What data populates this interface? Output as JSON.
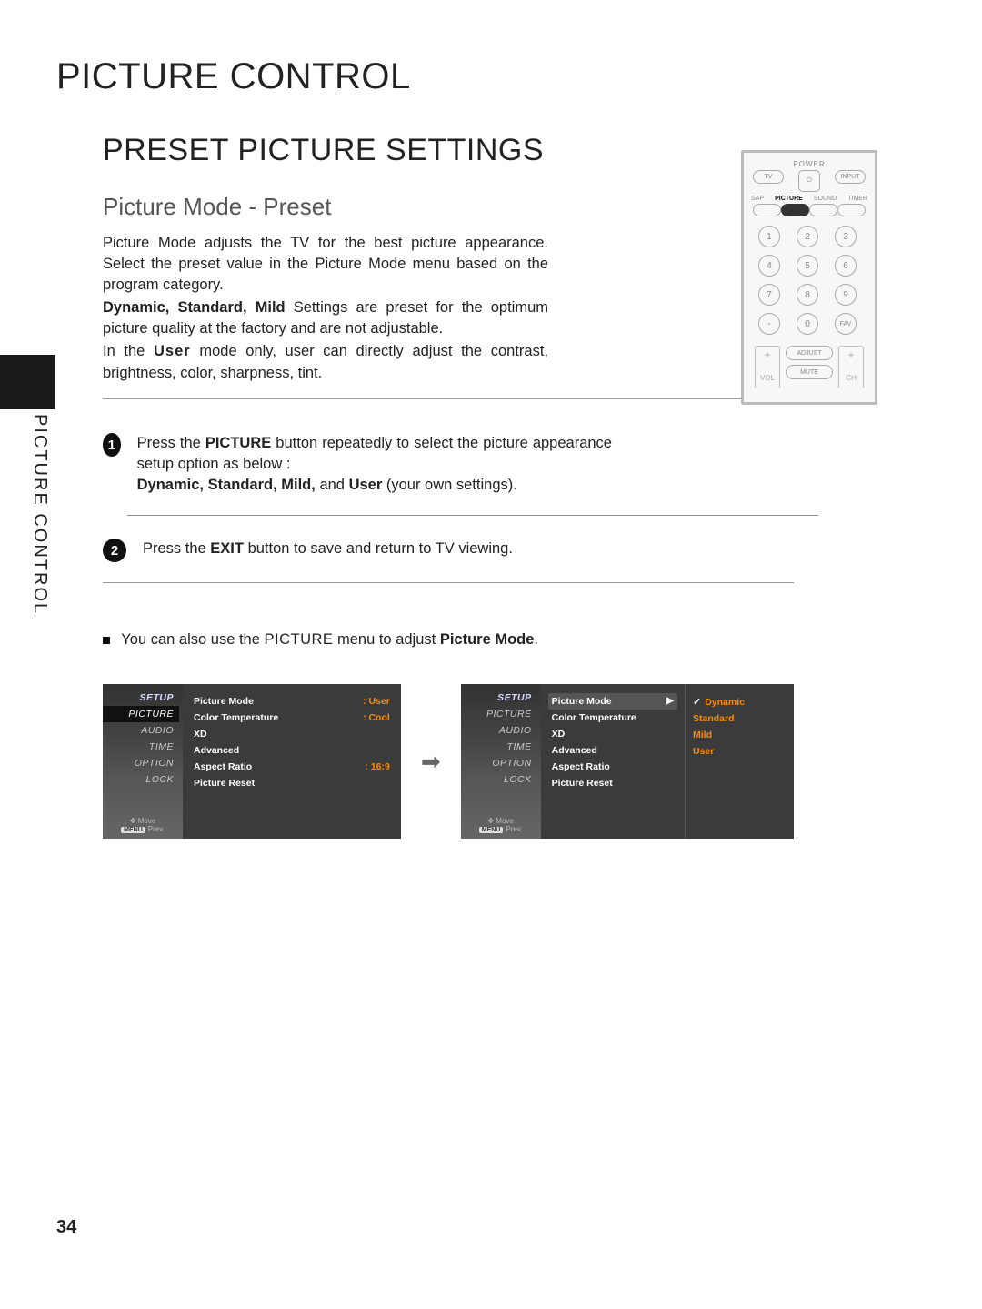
{
  "page": {
    "title": "PICTURE CONTROL",
    "section": "PRESET PICTURE SETTINGS",
    "subsection": "Picture Mode - Preset",
    "side_label": "PICTURE CONTROL",
    "page_number": "34"
  },
  "intro": {
    "p1a": "Picture Mode adjusts the TV for the best picture appearance. Select the preset value in the Picture Mode menu based on the program category.",
    "p2_bold": "Dynamic, Standard, Mild",
    "p2_rest": " Settings are preset for the optimum picture quality at the factory and are not adjustable.",
    "p3a": "In the ",
    "p3_user": "User",
    "p3b": " mode only, user can directly adjust the contrast, brightness, color, sharpness, tint."
  },
  "steps": {
    "s1": {
      "num": "1",
      "line1a": "Press the ",
      "line1b": "PICTURE",
      "line1c": " button repeatedly to select the picture appearance setup option as below :",
      "line2": "Dynamic, Standard, Mild,",
      "line2_and": " and ",
      "line2_user": "User",
      "line2_tail": " (your own settings)."
    },
    "s2": {
      "num": "2",
      "a": "Press the ",
      "b": "EXIT",
      "c": " button to save and return to TV viewing."
    }
  },
  "tip": {
    "a": "You can also use the ",
    "b": "PICTURE",
    "c": " menu to adjust ",
    "d": "Picture Mode",
    "e": "."
  },
  "remote": {
    "power": "POWER",
    "tv": "TV",
    "input": "INPUT",
    "sap": "SAP",
    "picture": "PICTURE",
    "sound": "SOUND",
    "timer": "TIMER",
    "nums": [
      "1",
      "2",
      "3",
      "4",
      "5",
      "6",
      "7",
      "8",
      "9",
      "-",
      "0",
      "FAV"
    ],
    "adjust": "ADJUST",
    "mute": "MUTE",
    "vol": "VOL",
    "ch": "CH",
    "plus": "+"
  },
  "osd": {
    "tabs": [
      "SETUP",
      "PICTURE",
      "AUDIO",
      "TIME",
      "OPTION",
      "LOCK"
    ],
    "move": "Move",
    "prev": "Prev.",
    "menu_prev": "MENU",
    "left": {
      "items": [
        {
          "label": "Picture Mode",
          "value": ": User"
        },
        {
          "label": "Color Temperature",
          "value": ": Cool"
        },
        {
          "label": "XD",
          "value": ""
        },
        {
          "label": "Advanced",
          "value": ""
        },
        {
          "label": "Aspect Ratio",
          "value": ": 16:9"
        },
        {
          "label": "Picture Reset",
          "value": ""
        }
      ]
    },
    "right": {
      "items": [
        {
          "label": "Picture Mode",
          "arrow": true
        },
        {
          "label": "Color Temperature"
        },
        {
          "label": "XD"
        },
        {
          "label": "Advanced"
        },
        {
          "label": "Aspect Ratio"
        },
        {
          "label": "Picture Reset"
        }
      ],
      "options": [
        "Dynamic",
        "Standard",
        "Mild",
        "User"
      ]
    },
    "arrow_between": "➡"
  }
}
